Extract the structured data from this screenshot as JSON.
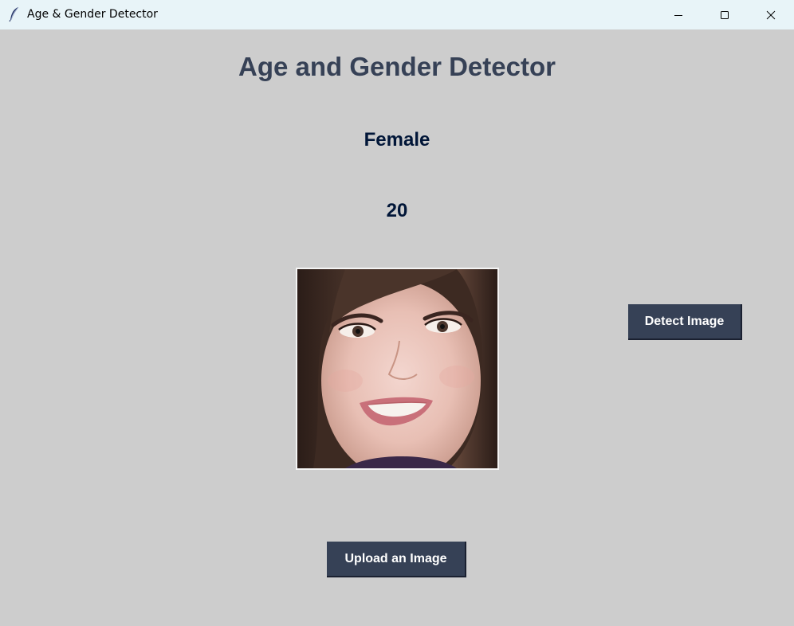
{
  "window": {
    "title": "Age & Gender Detector",
    "icon": "feather-icon",
    "controls": {
      "minimize": "minimize-icon",
      "maximize": "maximize-icon",
      "close": "close-icon"
    }
  },
  "main": {
    "heading": "Age and Gender Detector",
    "gender": "Female",
    "age": "20",
    "image": {
      "kind": "photo",
      "subject": "face"
    },
    "detect_button": "Detect Image",
    "upload_button": "Upload an Image"
  },
  "colors": {
    "background": "#cdcdcd",
    "heading": "#364156",
    "result_text": "#011638",
    "button_bg": "#364156",
    "button_text": "#ffffff",
    "titlebar": "#e8f4f8"
  }
}
